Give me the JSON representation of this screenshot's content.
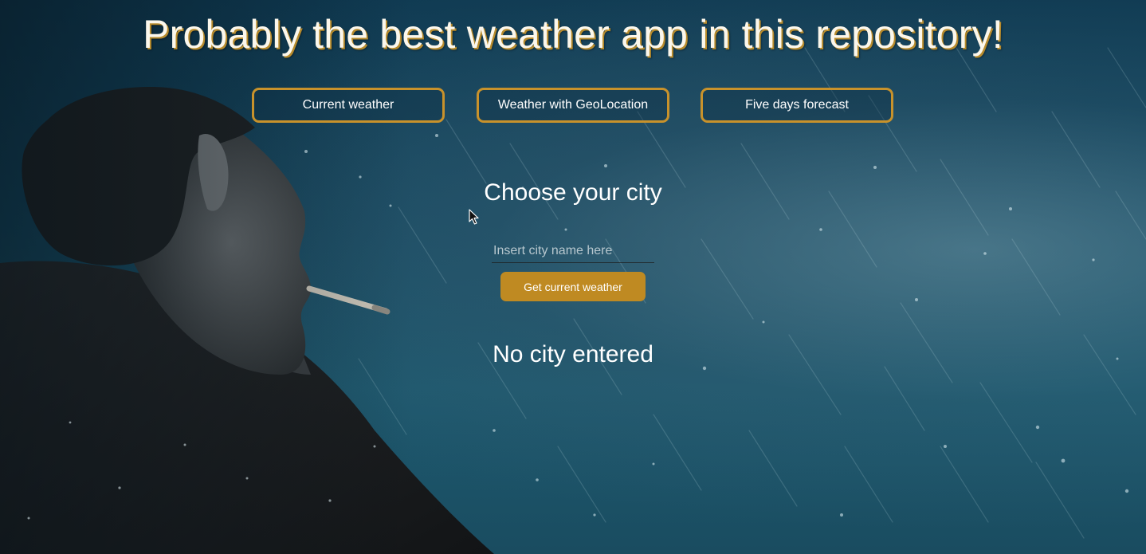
{
  "app": {
    "title": "Probably the best weather app in this repository!"
  },
  "nav": {
    "items": [
      {
        "label": "Current weather"
      },
      {
        "label": "Weather with GeoLocation"
      },
      {
        "label": "Five days forecast"
      }
    ]
  },
  "main": {
    "heading": "Choose your city",
    "search": {
      "placeholder": "Insert city name here",
      "value": ""
    },
    "submit_label": "Get current weather",
    "result_text": "No city entered"
  },
  "colors": {
    "accent": "#c8922b",
    "button_fill": "#bf8a22",
    "background": "#154a63",
    "text": "#ffffff"
  },
  "icons": {
    "cursor": "mouse-pointer-icon"
  }
}
